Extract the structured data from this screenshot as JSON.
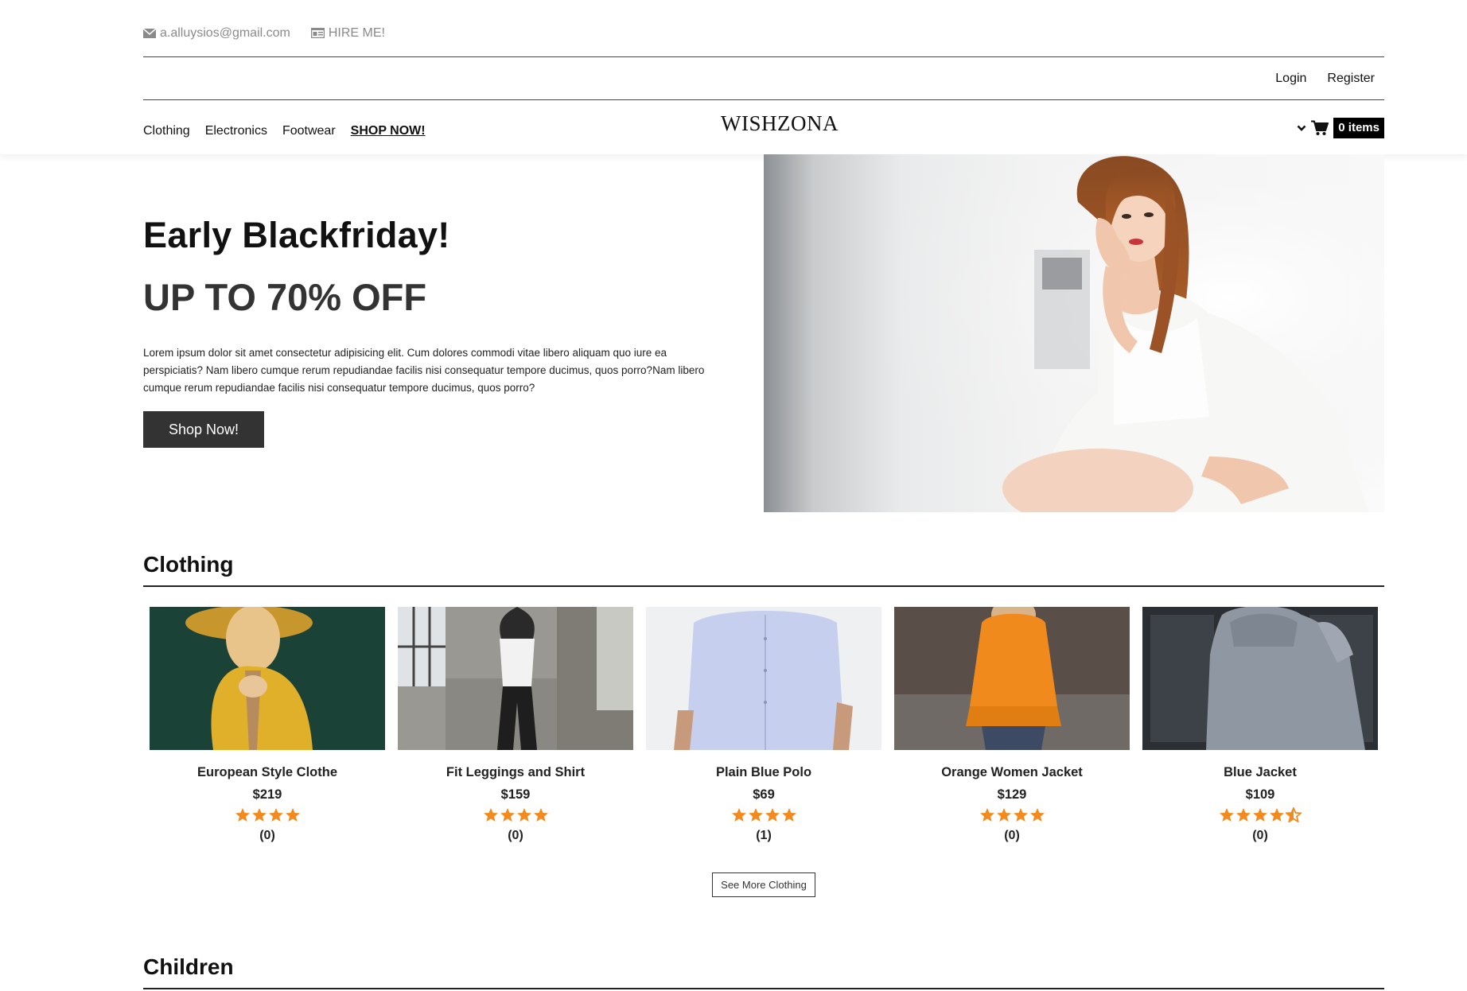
{
  "topbar": {
    "email": "a.alluysios@gmail.com",
    "hire": "HIRE ME!"
  },
  "auth": {
    "login": "Login",
    "register": "Register"
  },
  "nav": {
    "links": [
      "Clothing",
      "Electronics",
      "Footwear"
    ],
    "shop_now": "SHOP NOW!",
    "brand": "WISHZONA",
    "cart_badge": "0 items"
  },
  "hero": {
    "title": "Early Blackfriday!",
    "subtitle": "UP TO 70% OFF",
    "description": "Lorem ipsum dolor sit amet consectetur adipisicing elit. Cum dolores commodi vitae libero aliquam quo iure ea perspiciatis? Nam libero cumque rerum repudiandae facilis nisi consequatur tempore ducimus, quos porro?Nam libero cumque rerum repudiandae facilis nisi consequatur tempore ducimus, quos porro?",
    "button": "Shop Now!"
  },
  "clothing": {
    "title": "Clothing",
    "products": [
      {
        "name": "European Style Clothe",
        "price": "$219",
        "rating": 4,
        "count": "(0)"
      },
      {
        "name": "Fit Leggings and Shirt",
        "price": "$159",
        "rating": 4,
        "count": "(0)"
      },
      {
        "name": "Plain Blue Polo",
        "price": "$69",
        "rating": 4,
        "count": "(1)"
      },
      {
        "name": "Orange Women Jacket",
        "price": "$129",
        "rating": 4,
        "count": "(0)"
      },
      {
        "name": "Blue Jacket",
        "price": "$109",
        "rating": 4.5,
        "count": "(0)"
      }
    ],
    "see_more": "See More Clothing"
  },
  "children": {
    "title": "Children"
  },
  "colors": {
    "star": "#f28a1e",
    "dark_button": "#333333"
  }
}
